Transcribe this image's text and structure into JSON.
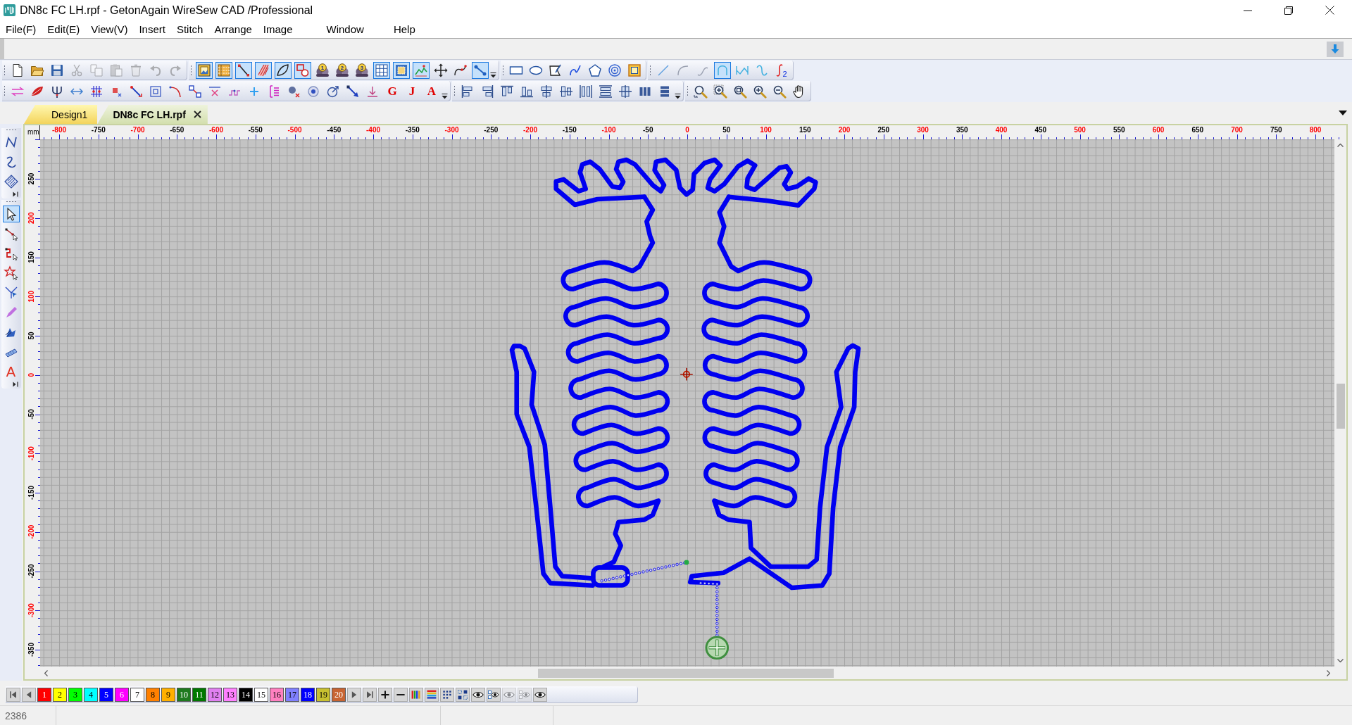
{
  "window": {
    "title": "DN8c FC LH.rpf - GetonAgain WireSew CAD /Professional"
  },
  "menu": [
    "File(F)",
    "Edit(E)",
    "View(V)",
    "Insert",
    "Stitch",
    "Arrange",
    "Image",
    "Window",
    "Help"
  ],
  "toolbars": {
    "file": [
      {
        "disabled": false
      },
      {
        "disabled": false
      },
      {
        "disabled": false
      },
      {
        "disabled": true
      },
      {
        "disabled": true
      },
      {
        "disabled": true
      },
      {
        "disabled": true
      },
      {
        "disabled": true
      },
      {
        "disabled": true
      }
    ],
    "view": [
      {
        "on": true
      },
      {
        "on": true
      },
      {
        "on": true
      },
      {
        "on": true
      },
      {
        "on": true
      },
      {
        "on": true
      },
      {
        "on": false,
        "label": "1"
      },
      {
        "on": false,
        "label": "2"
      },
      {
        "on": false,
        "label": "3"
      },
      {
        "on": true
      },
      {
        "on": true
      },
      {
        "on": true
      },
      {
        "on": false
      },
      {
        "on": false
      },
      {
        "on": true
      }
    ],
    "shapes": [
      {
        "on": false
      },
      {
        "on": false
      },
      {
        "on": false
      },
      {
        "on": false
      },
      {
        "on": false
      },
      {
        "on": false
      },
      {
        "on": false
      }
    ],
    "curves": [
      {
        "on": false
      },
      {
        "on": false
      },
      {
        "on": false
      },
      {
        "on": true
      },
      {
        "on": false
      },
      {
        "on": false
      },
      {
        "on": false,
        "label": "2"
      }
    ],
    "edit_letters": [
      {
        "label": "G"
      },
      {
        "label": "J"
      },
      {
        "label": "A"
      }
    ]
  },
  "tabs": [
    {
      "label": "Design1",
      "selected": false
    },
    {
      "label": "DN8c FC LH.rpf",
      "selected": true
    }
  ],
  "side_toolbar": {
    "draw": [
      {
        "on": false
      },
      {
        "on": false
      },
      {
        "on": false
      }
    ],
    "tools": [
      {
        "on": true
      },
      {
        "on": false
      },
      {
        "on": false
      },
      {
        "on": false
      },
      {
        "on": false
      },
      {
        "on": false
      },
      {
        "on": false
      },
      {
        "on": false
      },
      {
        "on": false,
        "label": "A"
      }
    ]
  },
  "rulers": {
    "unit": "mm",
    "horizontal": [
      {
        "label": "-800",
        "color": "#ff0000"
      },
      {
        "label": "-750",
        "color": "#000000"
      },
      {
        "label": "-700",
        "color": "#ff0000"
      },
      {
        "label": "-650",
        "color": "#000000"
      },
      {
        "label": "-600",
        "color": "#ff0000"
      },
      {
        "label": "-550",
        "color": "#000000"
      },
      {
        "label": "-500",
        "color": "#ff0000"
      },
      {
        "label": "-450",
        "color": "#000000"
      },
      {
        "label": "-400",
        "color": "#ff0000"
      },
      {
        "label": "-350",
        "color": "#000000"
      },
      {
        "label": "-300",
        "color": "#ff0000"
      },
      {
        "label": "-250",
        "color": "#000000"
      },
      {
        "label": "-200",
        "color": "#ff0000"
      },
      {
        "label": "-150",
        "color": "#000000"
      },
      {
        "label": "-100",
        "color": "#ff0000"
      },
      {
        "label": "-50",
        "color": "#000000"
      },
      {
        "label": "0",
        "color": "#ff0000"
      },
      {
        "label": "50",
        "color": "#000000"
      },
      {
        "label": "100",
        "color": "#ff0000"
      },
      {
        "label": "150",
        "color": "#000000"
      },
      {
        "label": "200",
        "color": "#ff0000"
      },
      {
        "label": "250",
        "color": "#000000"
      },
      {
        "label": "300",
        "color": "#ff0000"
      },
      {
        "label": "350",
        "color": "#000000"
      },
      {
        "label": "400",
        "color": "#ff0000"
      },
      {
        "label": "450",
        "color": "#000000"
      },
      {
        "label": "500",
        "color": "#ff0000"
      },
      {
        "label": "550",
        "color": "#000000"
      },
      {
        "label": "600",
        "color": "#ff0000"
      },
      {
        "label": "650",
        "color": "#000000"
      },
      {
        "label": "700",
        "color": "#ff0000"
      },
      {
        "label": "750",
        "color": "#000000"
      },
      {
        "label": "800",
        "color": "#ff0000"
      }
    ],
    "vertical": [
      {
        "label": "250",
        "color": "#000000"
      },
      {
        "label": "200",
        "color": "#ff0000"
      },
      {
        "label": "150",
        "color": "#000000"
      },
      {
        "label": "100",
        "color": "#ff0000"
      },
      {
        "label": "50",
        "color": "#000000"
      },
      {
        "label": "0",
        "color": "#ff0000"
      },
      {
        "label": "-50",
        "color": "#000000"
      },
      {
        "label": "-100",
        "color": "#ff0000"
      },
      {
        "label": "-150",
        "color": "#000000"
      },
      {
        "label": "-200",
        "color": "#ff0000"
      },
      {
        "label": "-250",
        "color": "#000000"
      },
      {
        "label": "-300",
        "color": "#ff0000"
      },
      {
        "label": "-350",
        "color": "#000000"
      }
    ]
  },
  "color_bar": {
    "tools": [
      {
        "disabled": false
      },
      {
        "disabled": false
      },
      {
        "disabled": false
      },
      {
        "disabled": false
      },
      {
        "disabled": false
      },
      {
        "disabled": false
      },
      {
        "disabled": false
      },
      {
        "disabled": false
      },
      {
        "disabled": false
      },
      {
        "disabled": false
      },
      {
        "disabled": false
      },
      {
        "disabled": false
      },
      {
        "disabled": true
      },
      {
        "disabled": true
      },
      {
        "disabled": false
      }
    ],
    "swatches": [
      {
        "label": "1",
        "color": "#ff0000"
      },
      {
        "label": "2",
        "color": "#ffff00"
      },
      {
        "label": "3",
        "color": "#00ff00"
      },
      {
        "label": "4",
        "color": "#00ffff"
      },
      {
        "label": "5",
        "color": "#0000ff"
      },
      {
        "label": "6",
        "color": "#ff00ff"
      },
      {
        "label": "7",
        "color": "#ffffff"
      },
      {
        "label": "8",
        "color": "#ff8000"
      },
      {
        "label": "9",
        "color": "#ffb000"
      },
      {
        "label": "10",
        "color": "#1e7a1e"
      },
      {
        "label": "11",
        "color": "#007800"
      },
      {
        "label": "12",
        "color": "#e080f0"
      },
      {
        "label": "13",
        "color": "#ff80ff"
      },
      {
        "label": "14",
        "color": "#000000"
      },
      {
        "label": "15",
        "color": "#ffffff"
      },
      {
        "label": "16",
        "color": "#ff80c0"
      },
      {
        "label": "17",
        "color": "#8080ff"
      },
      {
        "label": "18",
        "color": "#0000ff"
      },
      {
        "label": "19",
        "color": "#c8c030"
      },
      {
        "label": "20",
        "color": "#c86432"
      }
    ]
  },
  "status_bar": {
    "text": "2386"
  }
}
